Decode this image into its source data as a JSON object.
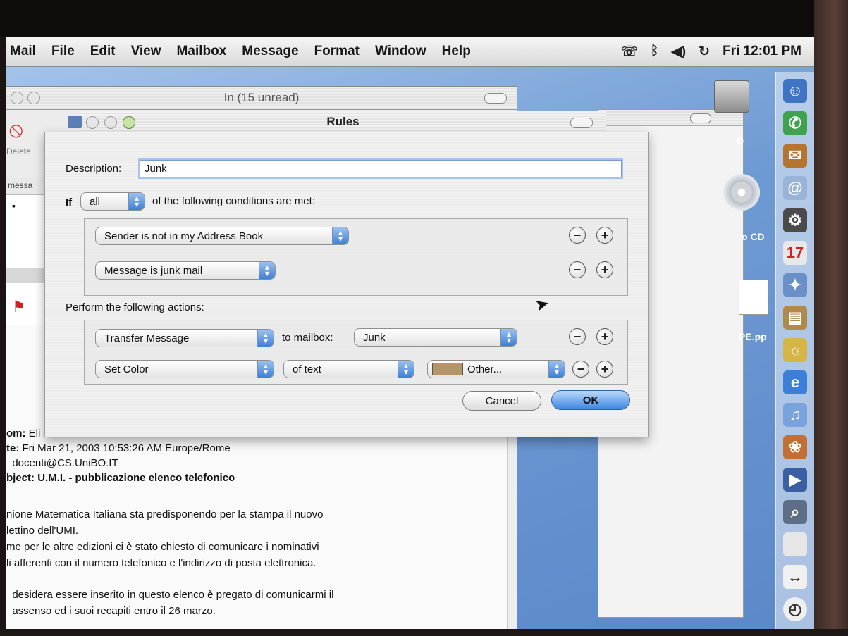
{
  "menubar": {
    "app": "Mail",
    "items": [
      "File",
      "Edit",
      "View",
      "Mailbox",
      "Message",
      "Format",
      "Window",
      "Help"
    ],
    "clock": "Fri 12:01 PM"
  },
  "mail_window": {
    "title": "In (15 unread)",
    "toolbar": {
      "delete_label": "Delete"
    },
    "list_header_partial": "messa",
    "headers": [
      {
        "key": "om:",
        "value": "Eli"
      },
      {
        "key": "te:",
        "value": "Fri Mar 21, 2003  10:53:26 AM Europe/Rome"
      },
      {
        "key": "",
        "value": "docenti@CS.UniBO.IT"
      },
      {
        "key": "bject:",
        "value": "U.M.I. - pubblicazione elenco telefonico"
      }
    ],
    "body_lines": [
      "nione Matematica Italiana  sta predisponendo per la stampa il nuovo",
      "lettino dell'UMI.",
      "me per le altre edizioni ci è stato chiesto di comunicare i nominativi",
      "li afferenti con il numero telefonico e l'indirizzo di posta elettronica.",
      "",
      "desidera essere inserito in questo elenco è pregato di comunicarmi il",
      "assenso ed i suoi recapiti entro il 26 marzo."
    ]
  },
  "desktop": {
    "labels": [
      "D",
      "o CD",
      "PE.pp"
    ]
  },
  "rules": {
    "title": "Rules",
    "description_label": "Description:",
    "description_value": "Junk",
    "if_label": "If",
    "match_value": "all",
    "conditions_text": "of the following conditions are met:",
    "conditions": [
      {
        "field": "Sender is not in my Address Book"
      },
      {
        "field": "Message is junk mail"
      }
    ],
    "actions_label": "Perform the following actions:",
    "actions": [
      {
        "action": "Transfer Message",
        "connector": "to mailbox:",
        "target": "Junk"
      },
      {
        "action": "Set Color",
        "target": "of text",
        "color_label": "Other...",
        "color": "#b5946a"
      }
    ],
    "cancel_label": "Cancel",
    "ok_label": "OK",
    "remove_symbol": "−",
    "add_symbol": "+"
  }
}
